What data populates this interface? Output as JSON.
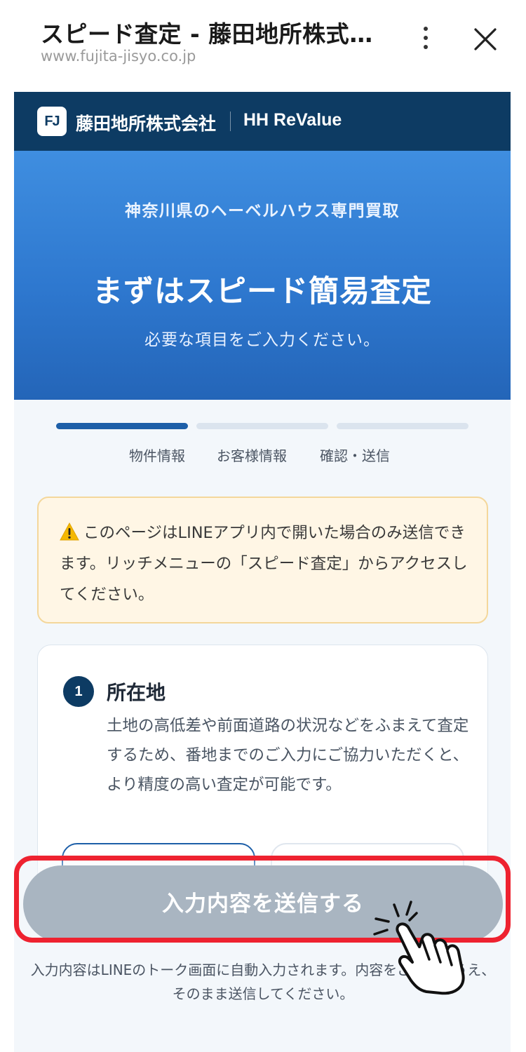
{
  "browser": {
    "title": "スピード査定 - 藤田地所株式会...",
    "url": "www.fujita-jisyo.co.jp"
  },
  "brand": {
    "logo_text": "FJ",
    "company": "藤田地所株式会社",
    "product": "HH ReValue"
  },
  "hero": {
    "kicker": "神奈川県のヘーベルハウス専門買取",
    "title": "まずはスピード簡易査定",
    "subtitle": "必要な項目をご入力ください。"
  },
  "steps": [
    {
      "label": "物件情報",
      "active": true
    },
    {
      "label": "お客様情報",
      "active": false
    },
    {
      "label": "確認・送信",
      "active": false
    }
  ],
  "notice": {
    "text": "このページはLINEアプリ内で開いた場合のみ送信できます。リッチメニューの「スピード査定」からアクセスしてください。"
  },
  "section": {
    "number": "1",
    "title": "所在地",
    "description": "土地の高低差や前面道路の状況などをふまえて査定するため、番地までのご入力にご協力いただくと、より精度の高い査定が可能です。"
  },
  "submit": {
    "label": "入力内容を送信する"
  },
  "footer_note": "入力内容はLINEのトーク画面に自動入力されます。内容をご確認のうえ、そのまま送信してください。",
  "colors": {
    "brand_navy": "#0d3b63",
    "hero_blue": "#2e78cf",
    "button_disabled": "#a9b5c1",
    "highlight_red": "#ee2230",
    "notice_bg": "#fff6e5"
  },
  "icons": [
    "more-vert-icon",
    "close-icon",
    "warning-icon",
    "pointing-hand-icon"
  ]
}
